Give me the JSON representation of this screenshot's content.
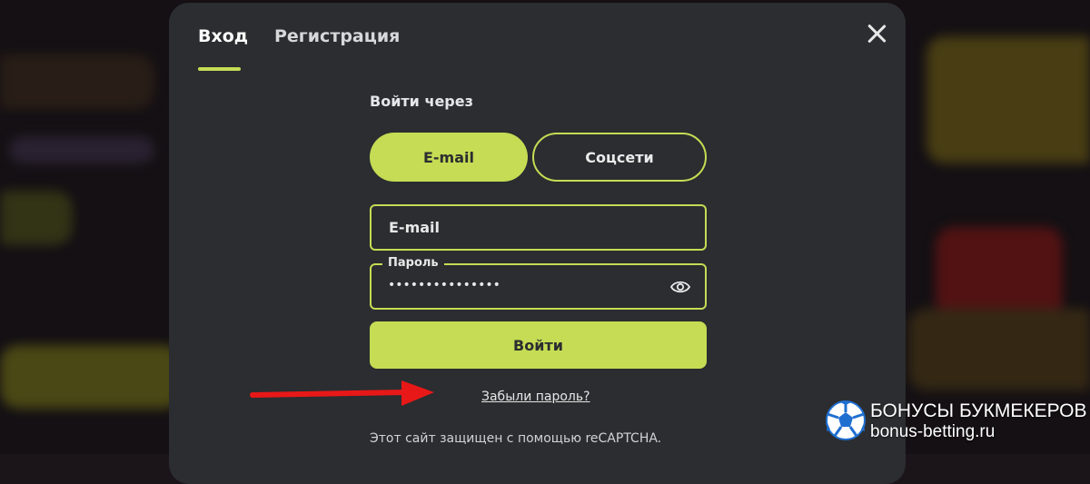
{
  "tabs": {
    "login_label": "Вход",
    "register_label": "Регистрация"
  },
  "login_via_label": "Войти через",
  "methods": {
    "email_label": "E-mail",
    "social_label": "Соцсети"
  },
  "form": {
    "email_placeholder": "E-mail",
    "password_label": "Пароль",
    "password_value": "•••••••••••••••"
  },
  "submit_label": "Войти",
  "forgot_label": "Забыли пароль?",
  "recaptcha_text": "Этот сайт защищен с помощью reCAPTCHA.",
  "watermark": {
    "title": "БОНУСЫ БУКМЕКЕРОВ",
    "url": "bonus-betting.ru"
  },
  "colors": {
    "accent": "#c5dc54",
    "modal_bg": "#2b2d30",
    "arrow": "#e81818"
  },
  "icons": [
    "close-icon",
    "eye-icon",
    "soccer-ball-icon",
    "red-arrow-annotation"
  ]
}
